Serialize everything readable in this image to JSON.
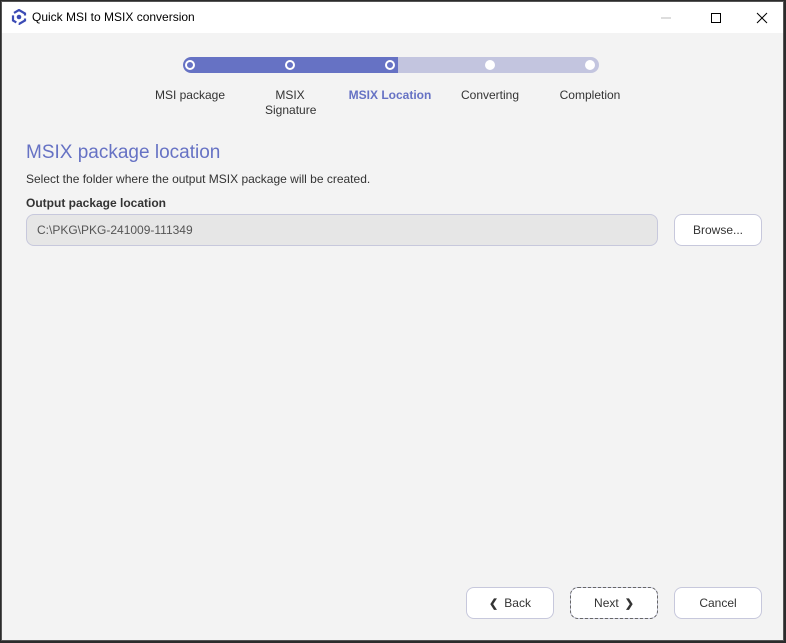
{
  "window": {
    "title": "Quick MSI to MSIX conversion",
    "controls": {
      "minimize": "minimize",
      "maximize": "maximize",
      "close": "close"
    }
  },
  "stepper": {
    "progress_steps_completed": 3,
    "total_steps": 5,
    "steps": [
      {
        "label": "MSI package",
        "state": "done"
      },
      {
        "label": "MSIX Signature",
        "state": "done"
      },
      {
        "label": "MSIX Location",
        "state": "active"
      },
      {
        "label": "Converting",
        "state": "todo"
      },
      {
        "label": "Completion",
        "state": "todo"
      }
    ]
  },
  "page": {
    "heading": "MSIX package location",
    "description": "Select the folder where the output MSIX package will be created.",
    "field_label": "Output package location",
    "path_value": "C:\\PKG\\PKG-241009-111349",
    "browse_label": "Browse..."
  },
  "footer": {
    "back_label": "Back",
    "next_label": "Next",
    "cancel_label": "Cancel"
  },
  "colors": {
    "accent": "#6672c4",
    "track": "#c3c5df",
    "background": "#f3f3f3"
  }
}
